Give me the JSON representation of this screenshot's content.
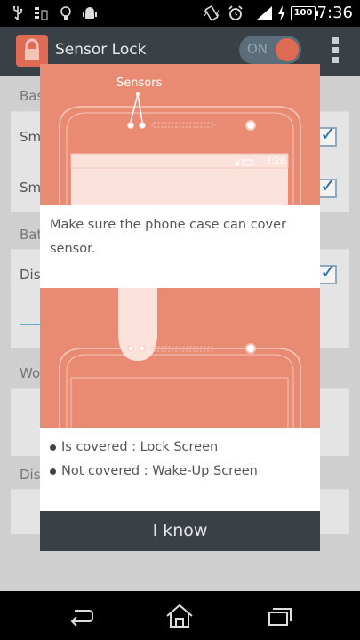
{
  "status_bar": {
    "time": "7:36",
    "battery": "100",
    "icons": [
      "usb-icon",
      "data-icon",
      "bulb-icon",
      "android-icon",
      "vibrate-icon",
      "alarm-icon",
      "signal-icon",
      "charging-icon"
    ]
  },
  "app": {
    "title": "Sensor Lock",
    "toggle_label": "ON",
    "accent": "#e06b55",
    "actionbar_color": "#394147"
  },
  "background": {
    "sections": [
      "Bas",
      "Bat",
      "Wo",
      "Dis"
    ],
    "rows": [
      "Sm",
      "Sm",
      "Disa"
    ]
  },
  "dialog": {
    "sensors_label": "Sensors",
    "phone_time": "7:20",
    "message": "Make sure the phone case can cover sensor.",
    "bullets": [
      "Is covered : Lock Screen",
      "Not covered : Wake-Up Screen"
    ],
    "button_label": "I know"
  },
  "nav": {
    "icons": [
      "back-icon",
      "home-icon",
      "recents-icon"
    ]
  }
}
